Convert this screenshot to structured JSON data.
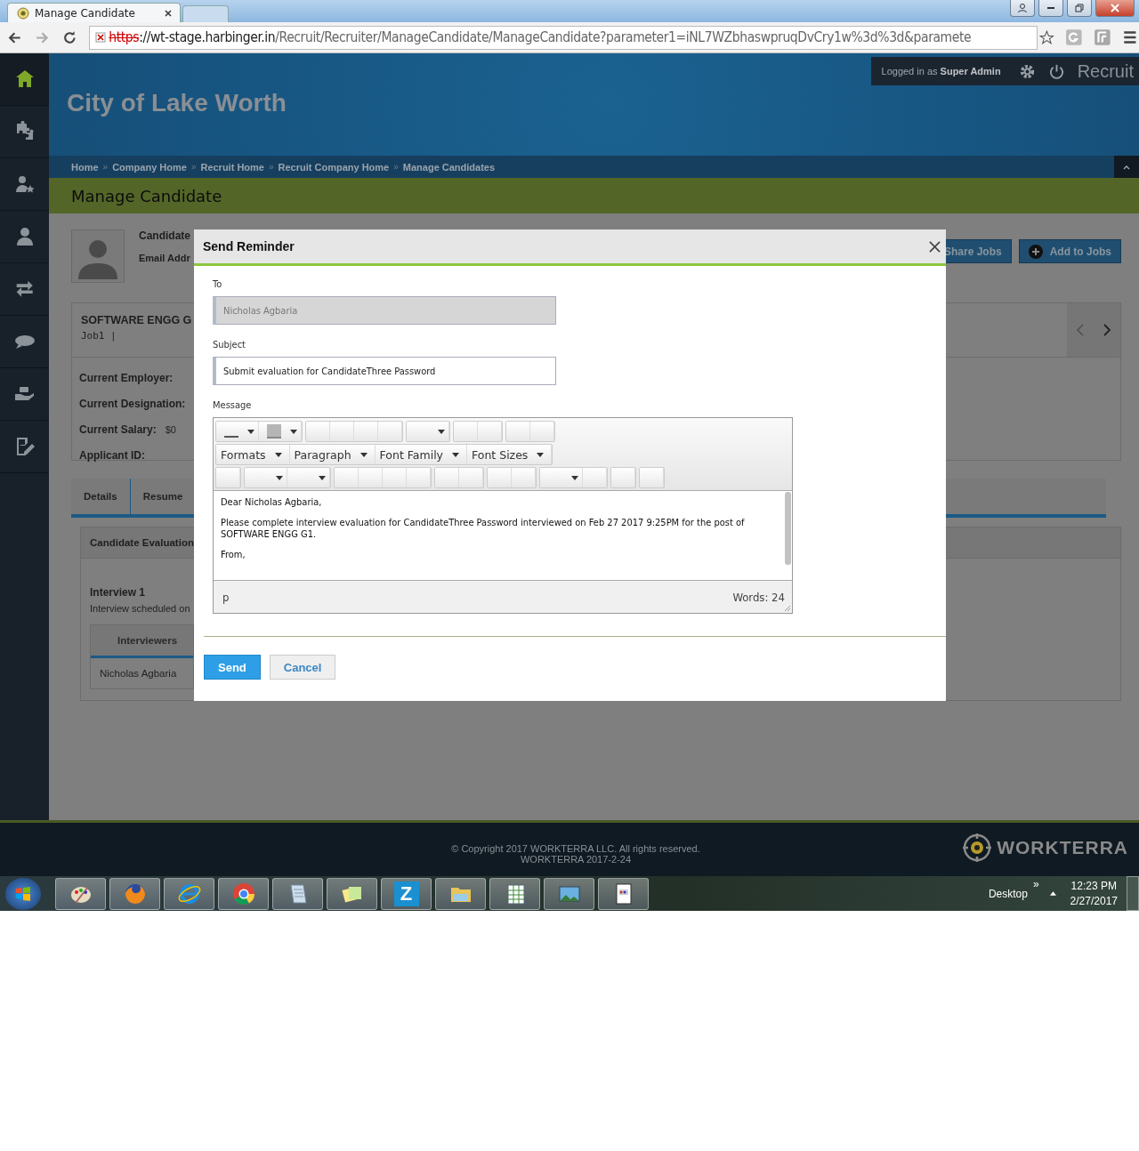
{
  "browser": {
    "tabs": [
      {
        "title": "Manage Candidate",
        "selected": true
      }
    ],
    "address": {
      "scheme": "https",
      "host": "://wt-stage.harbinger.in",
      "path": "/Recruit/Recruiter/ManageCandidate/ManageCandidate?parameter1=iNL7WZbhaswpruqDvCry1w%3d%3d&paramete"
    }
  },
  "sidebar": {
    "items": [
      {
        "kind": "home",
        "selected": true
      },
      {
        "kind": "puzzle",
        "selected": false
      },
      {
        "kind": "user-star",
        "selected": false
      },
      {
        "kind": "user",
        "selected": false
      },
      {
        "kind": "arrows",
        "selected": false
      },
      {
        "kind": "chat",
        "selected": false
      },
      {
        "kind": "hand",
        "selected": false
      },
      {
        "kind": "edit",
        "selected": false
      }
    ]
  },
  "header": {
    "org_name": "City of Lake Worth",
    "user_text": "Logged in as **Super Admin**",
    "app_name": "Recruit"
  },
  "breadcrumbs": {
    "separator": "»",
    "items": [
      "Home",
      "Company Home",
      "Recruit Home",
      "Recruit Company Home",
      "Manage Candidates"
    ]
  },
  "page_title": "Manage Candidate",
  "candidate": {
    "name_label": "Candidate",
    "email_label": "Email Addr"
  },
  "actions": [
    {
      "label": "Share Jobs",
      "kind": "plain"
    },
    {
      "label": "Add to Jobs",
      "kind": "add"
    }
  ],
  "job": {
    "title": "SOFTWARE ENGG G",
    "code": "Job1 |",
    "fields": [
      {
        "label": "Current Employer:"
      },
      {
        "label": "Current Designation:"
      },
      {
        "label": "Current Salary:",
        "value": "$0"
      },
      {
        "label": "Applicant ID:"
      }
    ]
  },
  "detail_tabs": [
    {
      "label": "Details",
      "selected": false
    },
    {
      "label": "Resume",
      "selected": false
    }
  ],
  "evaluation": {
    "title": "Candidate Evaluation",
    "interview_title": "Interview 1",
    "interview_note": "Interview scheduled on",
    "table": {
      "columns": [
        "Interviewers"
      ],
      "rows": [
        [
          "Nicholas Agbaria"
        ]
      ]
    }
  },
  "modal": {
    "title": "Send Reminder",
    "to": {
      "label": "To",
      "value": "Nicholas Agbaria",
      "disabled": true
    },
    "subject": {
      "label": "Subject",
      "value": "Submit evaluation for CandidateThree Password",
      "disabled": false
    },
    "message": {
      "label": "Message",
      "toolbar_rows": [
        [
          [
            {
              "kind": "underline"
            },
            {
              "kind": "swatch"
            }
          ],
          [
            {
              "kind": "plain"
            },
            {
              "kind": "plain"
            },
            {
              "kind": "plain"
            },
            {
              "kind": "plain"
            }
          ],
          [
            {
              "kind": "dropdown"
            }
          ],
          [
            {
              "kind": "plain"
            },
            {
              "kind": "plain"
            }
          ],
          [
            {
              "kind": "plain"
            },
            {
              "kind": "plain"
            }
          ]
        ],
        [
          [
            {
              "kind": "menu",
              "label": "Formats"
            },
            {
              "kind": "menu",
              "label": "Paragraph"
            },
            {
              "kind": "menu",
              "label": "Font Family"
            },
            {
              "kind": "menu",
              "label": "Font Sizes"
            }
          ]
        ],
        [
          [
            {
              "kind": "plain"
            }
          ],
          [
            {
              "kind": "dropdown"
            },
            {
              "kind": "dropdown"
            }
          ],
          [
            {
              "kind": "plain"
            },
            {
              "kind": "plain"
            },
            {
              "kind": "plain"
            },
            {
              "kind": "plain"
            }
          ],
          [
            {
              "kind": "plain"
            },
            {
              "kind": "plain"
            }
          ],
          [
            {
              "kind": "plain"
            },
            {
              "kind": "plain"
            }
          ],
          [
            {
              "kind": "dropdown"
            },
            {
              "kind": "plain"
            }
          ],
          [
            {
              "kind": "plain"
            }
          ],
          [
            {
              "kind": "plain"
            }
          ]
        ]
      ],
      "paragraphs": [
        "Dear Nicholas Agbaria,",
        "Please complete interview evaluation for CandidateThree Password interviewed on Feb 27 2017 9:25PM for the post of SOFTWARE ENGG G1.",
        "From,"
      ],
      "path": "p",
      "word_count": "Words: 24"
    },
    "buttons": [
      {
        "label": "Send",
        "kind": "primary"
      },
      {
        "label": "Cancel",
        "kind": "secondary"
      }
    ]
  },
  "footer": {
    "copyright": "© Copyright 2017 WORKTERRA LLC. All rights reserved.",
    "version": "WORKTERRA 2017-2-24",
    "logo": "WORKTERRA"
  },
  "taskbar": {
    "apps": [
      {
        "kind": "paint"
      },
      {
        "kind": "firefox"
      },
      {
        "kind": "ie"
      },
      {
        "kind": "chrome"
      },
      {
        "kind": "notepad"
      },
      {
        "kind": "notes"
      },
      {
        "kind": "letter",
        "label": "Z"
      },
      {
        "kind": "folder"
      },
      {
        "kind": "sheet"
      },
      {
        "kind": "image"
      },
      {
        "kind": "doc"
      }
    ],
    "desktop_label": "Desktop",
    "chevron": "»",
    "time": "12:23 PM",
    "date": "2/27/2017"
  }
}
